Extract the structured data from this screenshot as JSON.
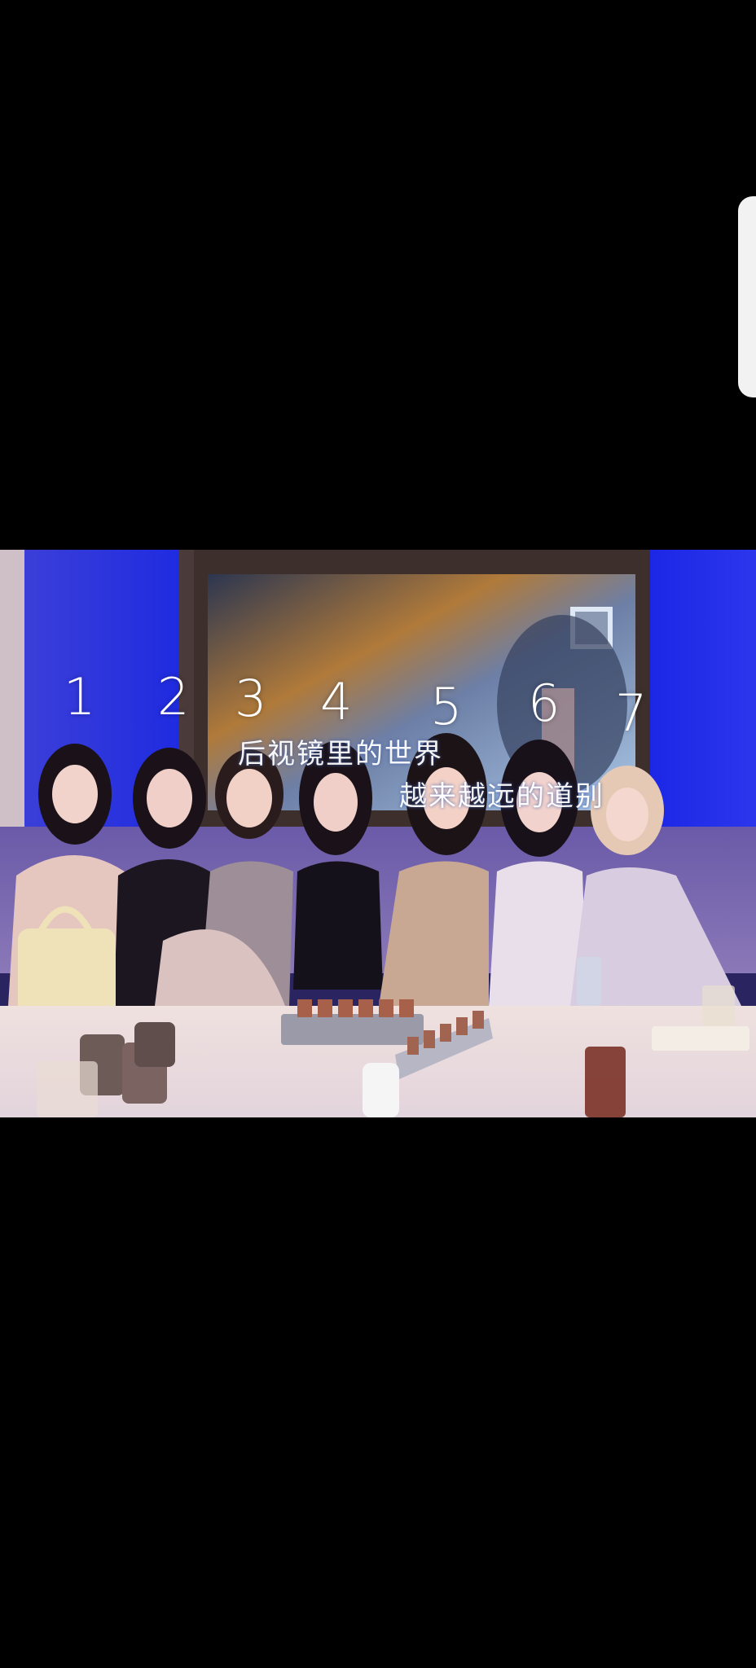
{
  "image": {
    "subject": "group-photo-karaoke-room",
    "colors": {
      "background": "#000000",
      "wall_blue": "#1f2ee8",
      "table": "#e9dcdf"
    }
  },
  "labels": [
    "1",
    "2",
    "3",
    "4",
    "5",
    "6",
    "7"
  ],
  "screen": {
    "lyric_line_1": "后视镜里的世界",
    "lyric_line_2": "越来越远的道别"
  }
}
